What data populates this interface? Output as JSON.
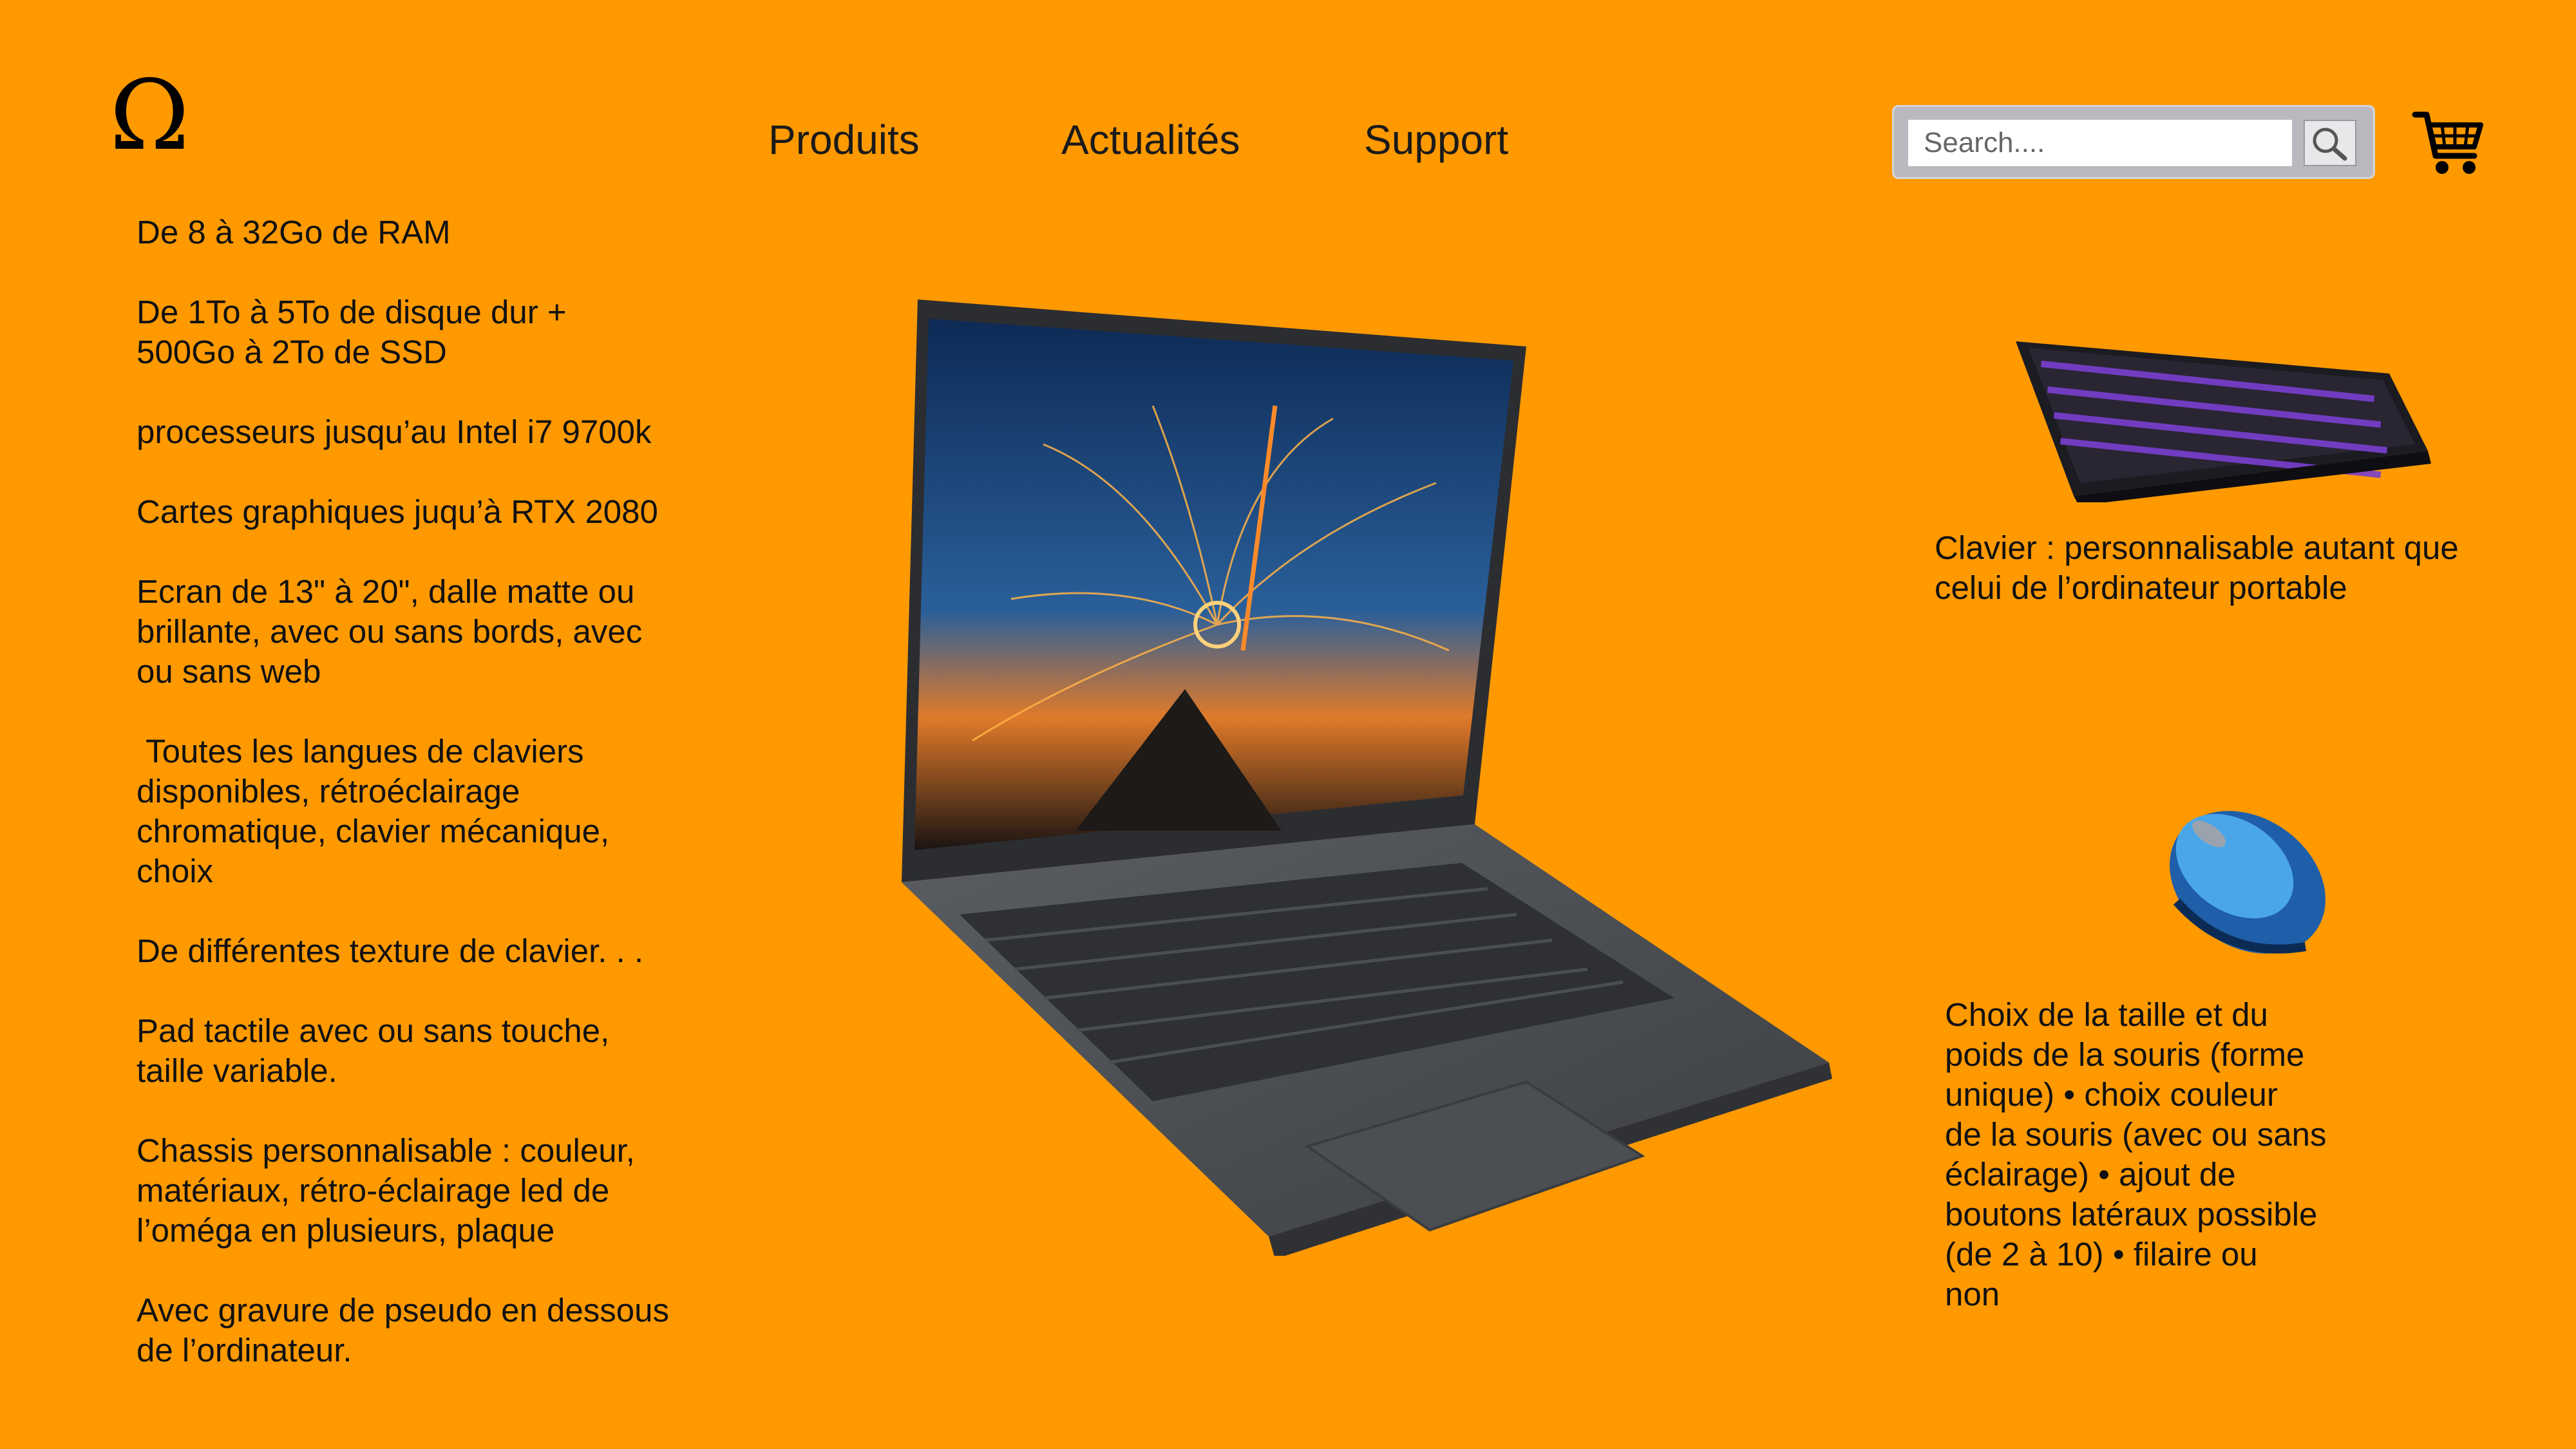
{
  "header": {
    "logo": "Ω",
    "nav": [
      "Produits",
      "Actualités",
      "Support"
    ],
    "search_placeholder": "Search....",
    "icons": {
      "search": "search-icon",
      "cart": "cart-icon"
    }
  },
  "specs": [
    "De 8 à 32Go de RAM",
    "De 1To à 5To de disque dur +\n500Go à 2To de SSD",
    "processeurs jusqu’au Intel i7 9700k",
    "Cartes graphiques juqu’à RTX 2080",
    "Ecran de 13\" à 20\", dalle matte ou\nbrillante, avec ou sans bords, avec\nou sans web",
    " Toutes les langues de claviers\ndisponibles, rétroéclairage\nchromatique, clavier mécanique,\nchoix",
    "De différentes texture de clavier. . .",
    "Pad tactile avec ou sans touche,\ntaille variable.",
    "Chassis personnalisable : couleur,\nmatériaux, rétro-éclairage led de\nl’oméga en plusieurs, plaque",
    "Avec gravure de pseudo en dessous\nde l’ordinateur."
  ],
  "keyboard_caption": "Clavier : personnalisable autant que\ncelui de l’ordinateur portable",
  "mouse_caption": "Choix de la taille et du\npoids de la souris (forme\nunique) • choix couleur\nde la souris (avec ou sans\néclairage) • ajout de\nboutons latéraux possible\n(de 2 à 10) • filaire ou\nnon",
  "colors": {
    "background": "#FF9900",
    "text": "#111111"
  }
}
